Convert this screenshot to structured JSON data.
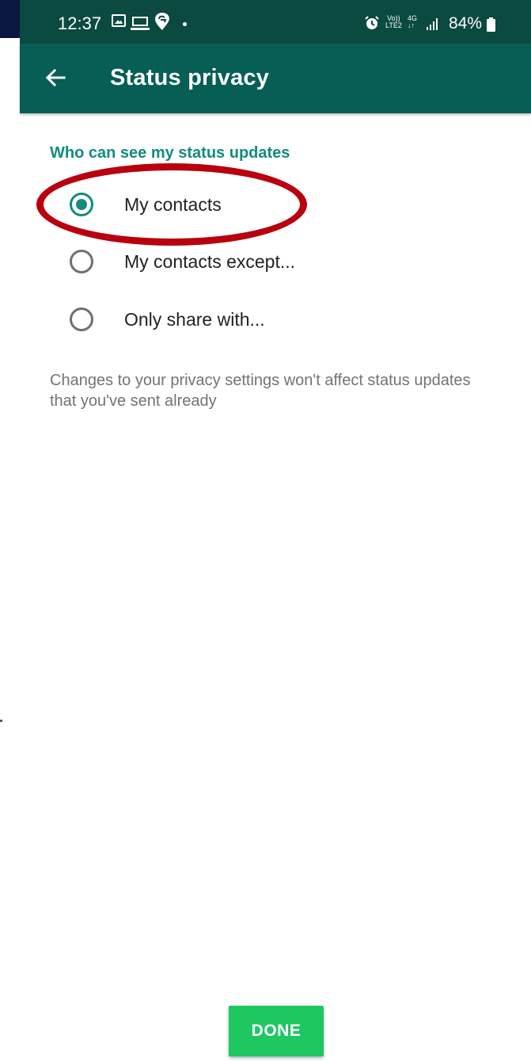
{
  "status_bar": {
    "time": "12:37",
    "volte_line1": "Vo))",
    "volte_line2": "LTE2",
    "network": "4G",
    "battery": "84%"
  },
  "app_bar": {
    "title": "Status privacy",
    "back_icon": "arrow-back-icon"
  },
  "privacy": {
    "section_header": "Who can see my status updates",
    "options": [
      {
        "label": "My contacts",
        "selected": true
      },
      {
        "label": "My contacts except...",
        "selected": false
      },
      {
        "label": "Only share with...",
        "selected": false
      }
    ],
    "note": "Changes to your privacy settings won't affect status updates that you've sent already"
  },
  "actions": {
    "done_label": "DONE"
  },
  "colors": {
    "app_bar": "#075e54",
    "status_bar": "#0b4a40",
    "accent": "#128c7e",
    "done_button": "#1ec762",
    "annotation": "#b8000f"
  }
}
